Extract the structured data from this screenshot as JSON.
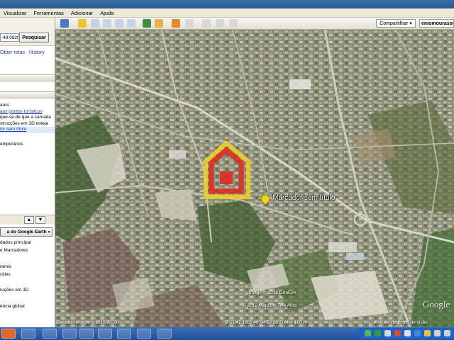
{
  "menu": [
    "Visualizar",
    "Ferramentas",
    "Adicionar",
    "Ajuda"
  ],
  "search": {
    "input_value": "-49.0828",
    "button_label": "Pesquisar",
    "links": [
      "Obter rotas",
      "History"
    ]
  },
  "places": {
    "lines": [
      "ares",
      "aos pontos turísticos",
      "que-se de que a camada",
      "strucções em 3D esteja",
      "lor sem título",
      "emporários"
    ]
  },
  "gallery_button": "a do Google Earth »",
  "layers": [
    "dados principal",
    "e Marcadores",
    "",
    "ramio",
    "cities",
    "",
    "ruções em 3D",
    "",
    "ência global"
  ],
  "toolbar": {
    "share_label": "Compartilhar ▾",
    "user": "eniomourasoa"
  },
  "map": {
    "marker_label": "Marcador sem título",
    "image_credit": "Image © 2012 GeoEye",
    "copyright": "© 2012 MapLink/Tele Atlas",
    "imagery_date": "Data das imagens: 8/10/2010",
    "coordinates": "5°21'42.10\"S  49°04'53.26\"O  elev  100 m",
    "altitude": "Altitude do ponto de visão",
    "logo": "Google"
  },
  "colors": {
    "marker_red": "#e02a1f",
    "marker_yellow": "#f2d21b",
    "taskbar": "#245edb"
  }
}
